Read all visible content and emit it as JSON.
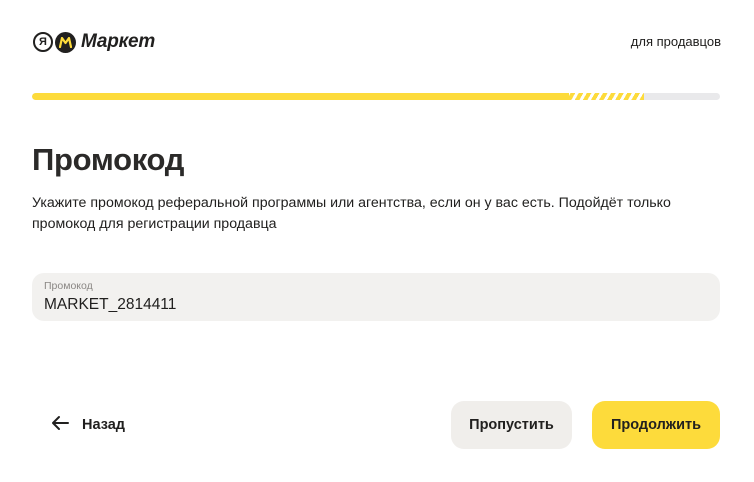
{
  "header": {
    "logo_ya": "Я",
    "logo_text": "Маркет",
    "for_sellers_link": "для продавцов"
  },
  "progress": {
    "fill_fraction": 0.78,
    "stripes_fraction": 0.11,
    "accent": "#fddb3b"
  },
  "page": {
    "title": "Промокод",
    "description": "Укажите промокод реферальной программы или агентства, если он у вас есть. Подойдёт только промокод для регистрации продавца"
  },
  "promo_field": {
    "label": "Промокод",
    "value": "MARKET_2814411"
  },
  "footer": {
    "back_label": "Назад",
    "back_icon": "arrow-left-icon",
    "skip_label": "Пропустить",
    "continue_label": "Продолжить"
  }
}
